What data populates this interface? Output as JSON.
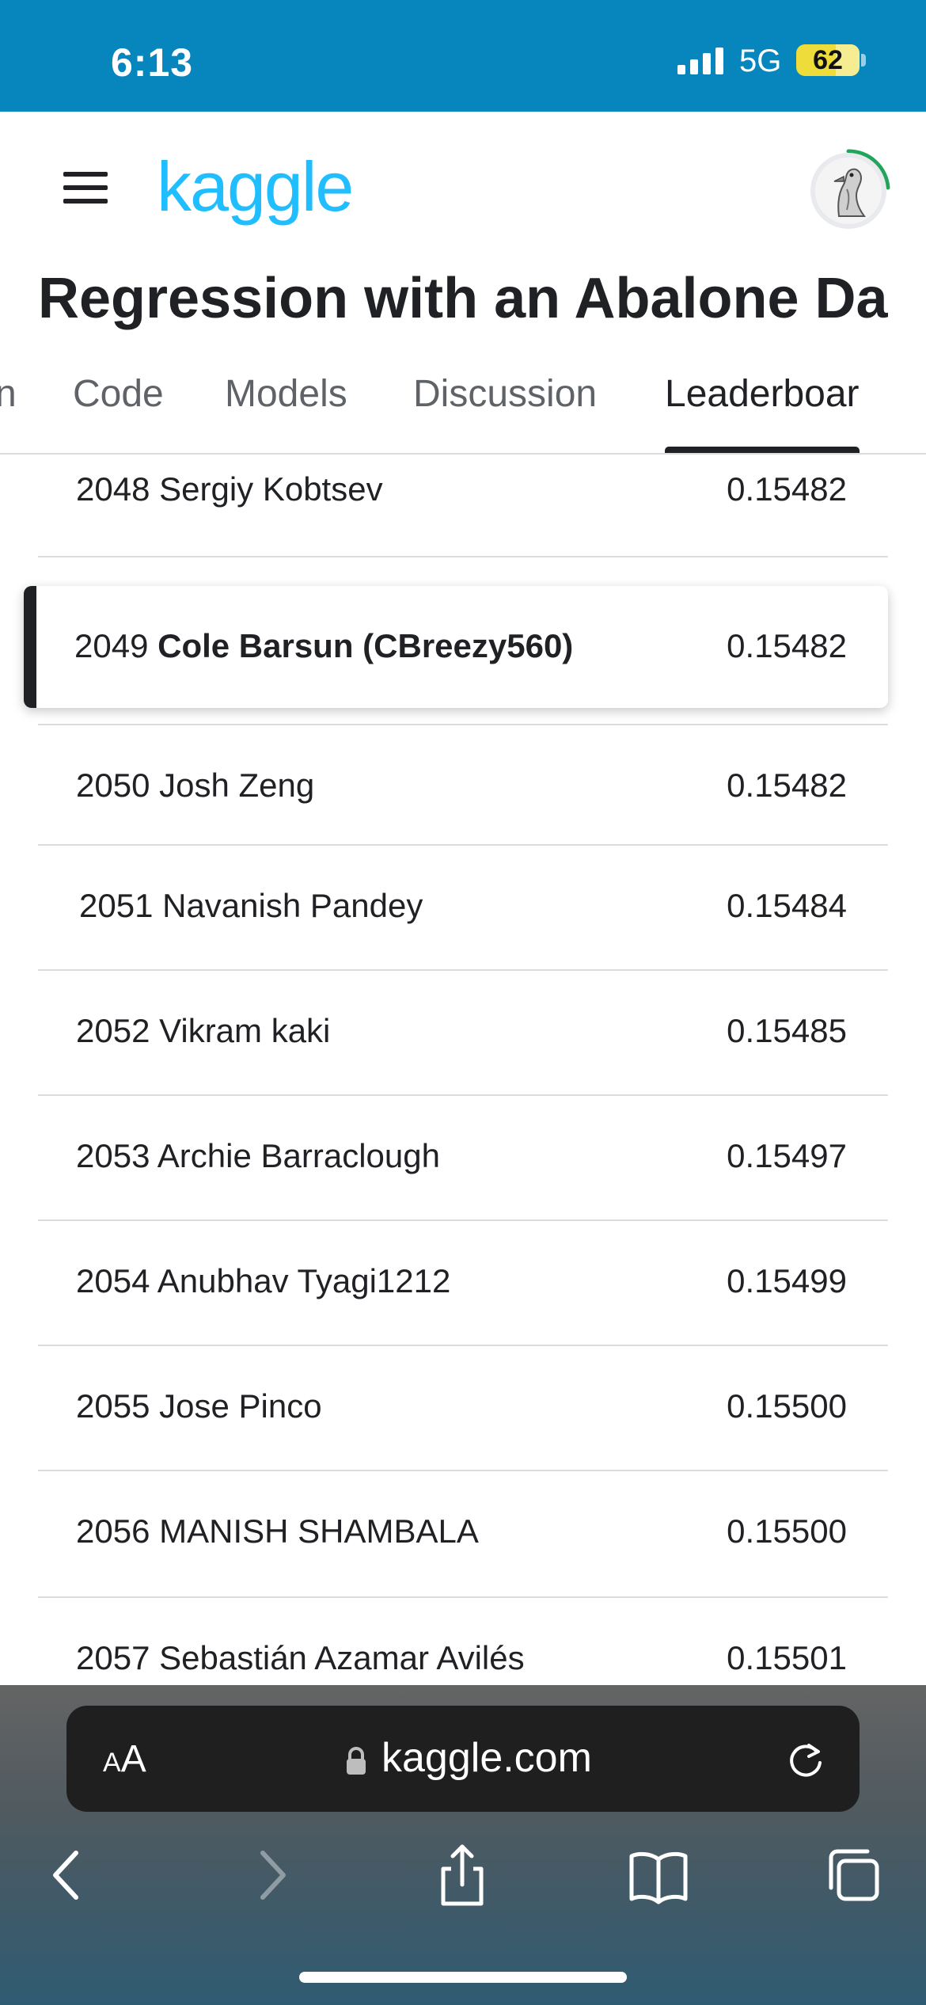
{
  "status_bar": {
    "time": "6:13",
    "network": "5G",
    "battery": "62",
    "battery_level": 0.62
  },
  "header": {
    "menu_icon": "hamburger-menu-icon",
    "logo_text": "kaggle",
    "avatar_icon": "goose-avatar-icon"
  },
  "competition": {
    "title": "Regression with an Abalone Da"
  },
  "tabs": [
    {
      "label": "n",
      "active": false
    },
    {
      "label": "Code",
      "active": false
    },
    {
      "label": "Models",
      "active": false
    },
    {
      "label": "Discussion",
      "active": false
    },
    {
      "label": "Leaderboar",
      "active": true
    }
  ],
  "leaderboard": {
    "rows": [
      {
        "rank": "2048",
        "name": "Sergiy Kobtsev",
        "score": "0.15482"
      },
      {
        "rank": "2049",
        "name": "Cole Barsun (CBreezy560)",
        "score": "0.15482",
        "highlight": true
      },
      {
        "rank": "2050",
        "name": "Josh Zeng",
        "score": "0.15482"
      },
      {
        "rank": "2051",
        "name": "Navanish Pandey",
        "score": "0.15484"
      },
      {
        "rank": "2052",
        "name": "Vikram kaki",
        "score": "0.15485"
      },
      {
        "rank": "2053",
        "name": "Archie Barraclough",
        "score": "0.15497"
      },
      {
        "rank": "2054",
        "name": "Anubhav Tyagi1212",
        "score": "0.15499"
      },
      {
        "rank": "2055",
        "name": "Jose Pinco",
        "score": "0.15500"
      },
      {
        "rank": "2056",
        "name": "MANISH SHAMBALA",
        "score": "0.15500"
      },
      {
        "rank": "2057",
        "name": "Sebastián Azamar Avilés",
        "score": "0.15501"
      }
    ]
  },
  "browser": {
    "aa_small": "A",
    "aa_large": "A",
    "url": "kaggle.com"
  }
}
